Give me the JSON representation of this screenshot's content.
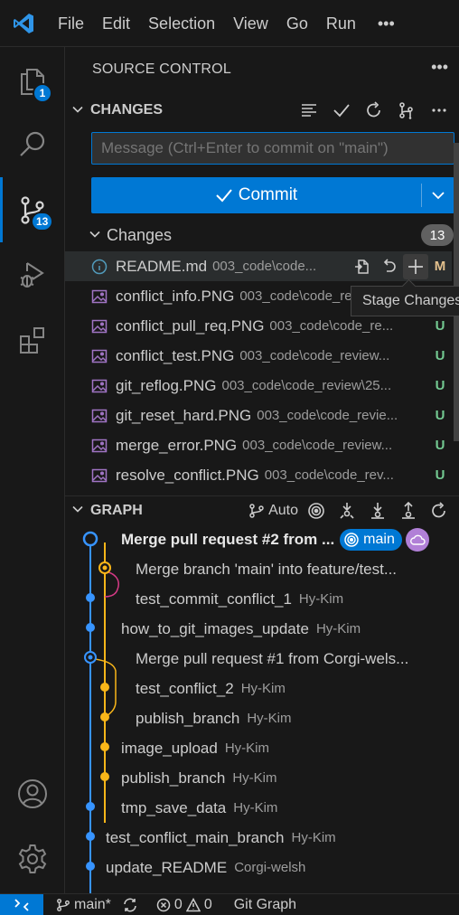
{
  "titlebar": {
    "menu": [
      "File",
      "Edit",
      "Selection",
      "View",
      "Go",
      "Run"
    ],
    "more": "•••"
  },
  "activity": {
    "explorer_badge": "1",
    "scm_badge": "13"
  },
  "sidebar": {
    "title": "SOURCE CONTROL",
    "more": "•••",
    "changes_section": "CHANGES",
    "message_placeholder": "Message (Ctrl+Enter to commit on \"main\")",
    "commit_label": "Commit",
    "changes_group": "Changes",
    "changes_count": "13",
    "files": [
      {
        "name": "README.md",
        "path": "003_code\\code...",
        "status": "M",
        "kind": "info"
      },
      {
        "name": "conflict_info.PNG",
        "path": "003_code\\code_review\\25...",
        "status": "U",
        "kind": "image"
      },
      {
        "name": "conflict_pull_req.PNG",
        "path": "003_code\\code_re...",
        "status": "U",
        "kind": "image"
      },
      {
        "name": "conflict_test.PNG",
        "path": "003_code\\code_review...",
        "status": "U",
        "kind": "image"
      },
      {
        "name": "git_reflog.PNG",
        "path": "003_code\\code_review\\25...",
        "status": "U",
        "kind": "image"
      },
      {
        "name": "git_reset_hard.PNG",
        "path": "003_code\\code_revie...",
        "status": "U",
        "kind": "image"
      },
      {
        "name": "merge_error.PNG",
        "path": "003_code\\code_review...",
        "status": "U",
        "kind": "image"
      },
      {
        "name": "resolve_conflict.PNG",
        "path": "003_code\\code_rev...",
        "status": "U",
        "kind": "image"
      }
    ],
    "tooltip": "Stage Changes",
    "graph_section": "GRAPH",
    "graph_auto": "Auto",
    "graph": [
      {
        "label": "Merge pull request #2 from ...",
        "author": "",
        "bold": true,
        "ref": "main"
      },
      {
        "label": "Merge branch 'main' into feature/test...",
        "author": ""
      },
      {
        "label": "test_commit_conflict_1",
        "author": "Hy-Kim"
      },
      {
        "label": "how_to_git_images_update",
        "author": "Hy-Kim"
      },
      {
        "label": "Merge pull request #1 from Corgi-wels...",
        "author": ""
      },
      {
        "label": "test_conflict_2",
        "author": "Hy-Kim"
      },
      {
        "label": "publish_branch",
        "author": "Hy-Kim"
      },
      {
        "label": "image_upload",
        "author": "Hy-Kim"
      },
      {
        "label": "publish_branch",
        "author": "Hy-Kim"
      },
      {
        "label": "tmp_save_data",
        "author": "Hy-Kim"
      },
      {
        "label": "test_conflict_main_branch",
        "author": "Hy-Kim"
      },
      {
        "label": "update_README",
        "author": "Corgi-welsh"
      }
    ]
  },
  "statusbar": {
    "branch": "main*",
    "errors": "0",
    "warnings": "0",
    "git_graph": "Git Graph"
  },
  "colors": {
    "accent": "#0078d4",
    "graph_blue": "#3794ff",
    "graph_orange": "#f9b619",
    "graph_pink": "#d63a86",
    "untracked": "#73c991",
    "modified": "#e2c08d"
  }
}
